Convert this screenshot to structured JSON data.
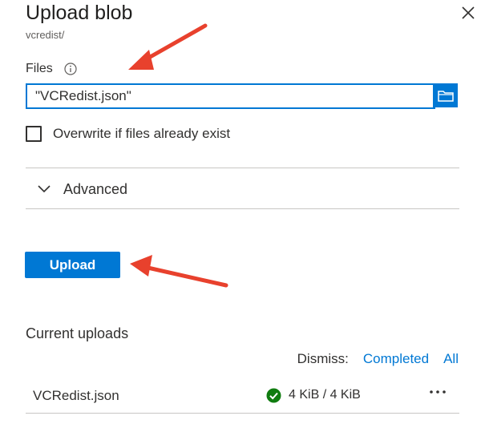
{
  "panel": {
    "title": "Upload blob",
    "subtitle": "vcredist/"
  },
  "form": {
    "files_label": "Files",
    "files_value": "\"VCRedist.json\"",
    "overwrite_label": "Overwrite if files already exist",
    "overwrite_checked": false,
    "advanced_label": "Advanced",
    "upload_button": "Upload"
  },
  "uploads": {
    "heading": "Current uploads",
    "dismiss_label": "Dismiss:",
    "dismiss_completed": "Completed",
    "dismiss_all": "All",
    "items": [
      {
        "filename": "VCRedist.json",
        "status": "4 KiB / 4 KiB",
        "state": "completed"
      }
    ]
  },
  "icons": {
    "close": "close-icon",
    "info": "info-icon",
    "browse": "folder-icon",
    "advanced": "chevron-down-icon",
    "status": "checkmark-circle-icon",
    "more": "more-icon"
  },
  "colors": {
    "accent": "#0078d4",
    "success": "#107c10",
    "annotation_arrow": "#e8412d"
  }
}
